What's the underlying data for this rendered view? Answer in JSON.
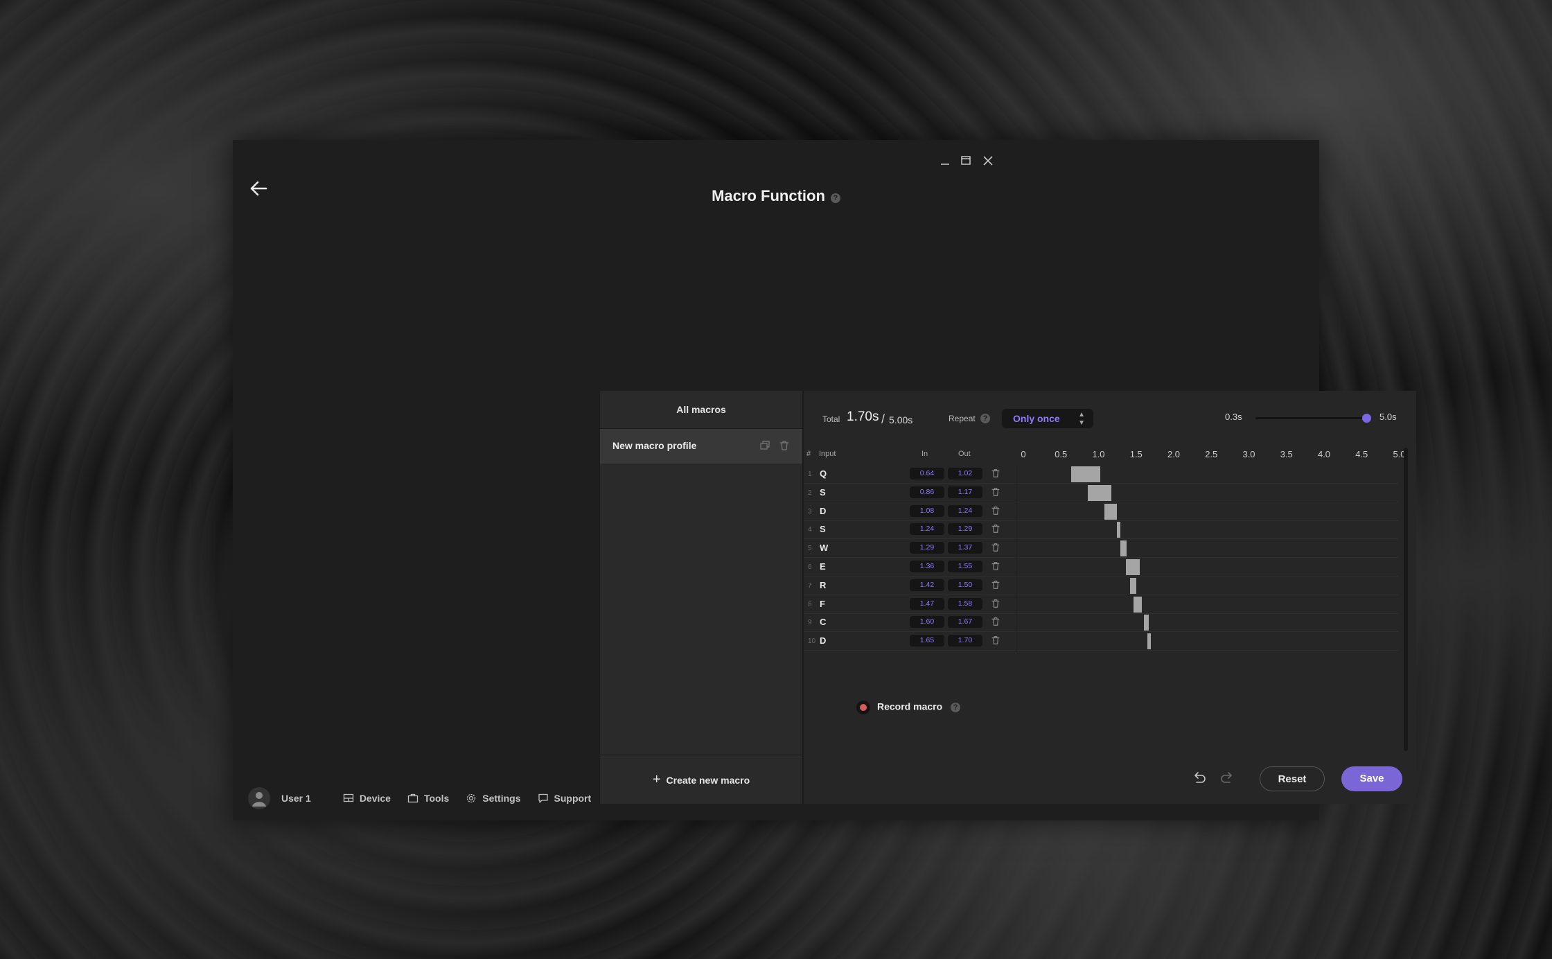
{
  "window": {
    "title": "Macro Function",
    "help_glyph": "?",
    "controls": [
      "minimize-icon",
      "maximize-icon",
      "close-icon"
    ]
  },
  "sidebar": {
    "header": "All macros",
    "items": [
      {
        "label": "New macro profile",
        "active": true
      }
    ],
    "create_label": "Create new macro",
    "create_glyph": "+"
  },
  "summary": {
    "total_label": "Total",
    "total_value": "1.70s",
    "separator": "/",
    "total_max": "5.00s",
    "repeat_label": "Repeat",
    "repeat_value": "Only once",
    "zoom_min": "0.3s",
    "zoom_max": "5.0s",
    "zoom_level": 1.0
  },
  "table": {
    "headers": {
      "index": "#",
      "input": "Input",
      "in": "In",
      "out": "Out"
    },
    "ticks": [
      "0",
      "0.5",
      "1.0",
      "1.5",
      "2.0",
      "2.5",
      "3.0",
      "3.5",
      "4.0",
      "4.5",
      "5.0"
    ],
    "rows": [
      {
        "num": "1",
        "key": "Q",
        "in": "0.64",
        "out": "1.02"
      },
      {
        "num": "2",
        "key": "S",
        "in": "0.86",
        "out": "1.17"
      },
      {
        "num": "3",
        "key": "D",
        "in": "1.08",
        "out": "1.24"
      },
      {
        "num": "4",
        "key": "S",
        "in": "1.24",
        "out": "1.29"
      },
      {
        "num": "5",
        "key": "W",
        "in": "1.29",
        "out": "1.37"
      },
      {
        "num": "6",
        "key": "E",
        "in": "1.36",
        "out": "1.55"
      },
      {
        "num": "7",
        "key": "R",
        "in": "1.42",
        "out": "1.50"
      },
      {
        "num": "8",
        "key": "F",
        "in": "1.47",
        "out": "1.58"
      },
      {
        "num": "9",
        "key": "C",
        "in": "1.60",
        "out": "1.67"
      },
      {
        "num": "10",
        "key": "D",
        "in": "1.65",
        "out": "1.70"
      }
    ]
  },
  "record": {
    "label": "Record macro"
  },
  "actions": {
    "reset": "Reset",
    "save": "Save"
  },
  "bottom_nav": {
    "user": "User 1",
    "items": [
      {
        "label": "Device",
        "icon": "device-icon"
      },
      {
        "label": "Tools",
        "icon": "tools-icon"
      },
      {
        "label": "Settings",
        "icon": "settings-icon"
      },
      {
        "label": "Support",
        "icon": "support-icon"
      }
    ]
  },
  "colors": {
    "accent": "#7b66d6",
    "accent_text": "#8f7bff",
    "record": "#d85a5a",
    "bar": "#a5a5a5"
  }
}
